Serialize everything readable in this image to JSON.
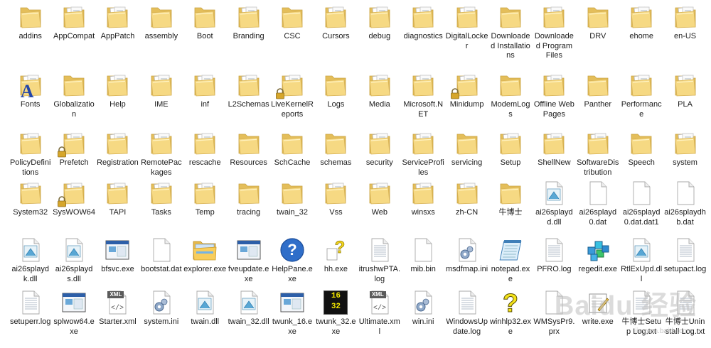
{
  "items": [
    {
      "label": "addins",
      "icon": "folder"
    },
    {
      "label": "AppCompat",
      "icon": "folder-docs"
    },
    {
      "label": "AppPatch",
      "icon": "folder-docs"
    },
    {
      "label": "assembly",
      "icon": "folder"
    },
    {
      "label": "Boot",
      "icon": "folder"
    },
    {
      "label": "Branding",
      "icon": "folder-docs"
    },
    {
      "label": "CSC",
      "icon": "folder"
    },
    {
      "label": "Cursors",
      "icon": "folder-docs"
    },
    {
      "label": "debug",
      "icon": "folder-docs"
    },
    {
      "label": "diagnostics",
      "icon": "folder-docs"
    },
    {
      "label": "DigitalLocker",
      "icon": "folder-docs"
    },
    {
      "label": "Downloaded Installations",
      "icon": "folder"
    },
    {
      "label": "Downloaded Program Files",
      "icon": "folder-docs"
    },
    {
      "label": "DRV",
      "icon": "folder"
    },
    {
      "label": "ehome",
      "icon": "folder-docs"
    },
    {
      "label": "en-US",
      "icon": "folder-docs"
    },
    {
      "label": "Fonts",
      "icon": "folder-fonts"
    },
    {
      "label": "Globalization",
      "icon": "folder"
    },
    {
      "label": "Help",
      "icon": "folder-docs"
    },
    {
      "label": "IME",
      "icon": "folder-docs"
    },
    {
      "label": "inf",
      "icon": "folder-docs"
    },
    {
      "label": "L2Schemas",
      "icon": "folder-docs"
    },
    {
      "label": "LiveKernelReports",
      "icon": "folder-locked"
    },
    {
      "label": "Logs",
      "icon": "folder"
    },
    {
      "label": "Media",
      "icon": "folder-docs"
    },
    {
      "label": "Microsoft.NET",
      "icon": "folder-docs"
    },
    {
      "label": "Minidump",
      "icon": "folder-locked"
    },
    {
      "label": "ModemLogs",
      "icon": "folder"
    },
    {
      "label": "Offline Web Pages",
      "icon": "folder-docs"
    },
    {
      "label": "Panther",
      "icon": "folder"
    },
    {
      "label": "Performance",
      "icon": "folder-docs"
    },
    {
      "label": "PLA",
      "icon": "folder-docs"
    },
    {
      "label": "PolicyDefinitions",
      "icon": "folder-docs"
    },
    {
      "label": "Prefetch",
      "icon": "folder-locked"
    },
    {
      "label": "Registration",
      "icon": "folder-docs"
    },
    {
      "label": "RemotePackages",
      "icon": "folder-docs"
    },
    {
      "label": "rescache",
      "icon": "folder-docs"
    },
    {
      "label": "Resources",
      "icon": "folder"
    },
    {
      "label": "SchCache",
      "icon": "folder"
    },
    {
      "label": "schemas",
      "icon": "folder"
    },
    {
      "label": "security",
      "icon": "folder-docs"
    },
    {
      "label": "ServiceProfiles",
      "icon": "folder-docs"
    },
    {
      "label": "servicing",
      "icon": "folder"
    },
    {
      "label": "Setup",
      "icon": "folder-docs"
    },
    {
      "label": "ShellNew",
      "icon": "folder-docs"
    },
    {
      "label": "SoftwareDistribution",
      "icon": "folder-docs"
    },
    {
      "label": "Speech",
      "icon": "folder"
    },
    {
      "label": "system",
      "icon": "folder-docs"
    },
    {
      "label": "System32",
      "icon": "folder-docs"
    },
    {
      "label": "SysWOW64",
      "icon": "folder-locked"
    },
    {
      "label": "TAPI",
      "icon": "folder-docs"
    },
    {
      "label": "Tasks",
      "icon": "folder-docs"
    },
    {
      "label": "Temp",
      "icon": "folder-docs"
    },
    {
      "label": "tracing",
      "icon": "folder"
    },
    {
      "label": "twain_32",
      "icon": "folder"
    },
    {
      "label": "Vss",
      "icon": "folder-docs"
    },
    {
      "label": "Web",
      "icon": "folder-docs"
    },
    {
      "label": "winsxs",
      "icon": "folder-docs"
    },
    {
      "label": "zh-CN",
      "icon": "folder-docs"
    },
    {
      "label": "牛博士",
      "icon": "folder"
    },
    {
      "label": "ai26splaydd.dll",
      "icon": "dll-file"
    },
    {
      "label": "ai26splayd0.dat",
      "icon": "blank-file"
    },
    {
      "label": "ai26splayd0.dat.dat1",
      "icon": "blank-file"
    },
    {
      "label": "ai26splaydhb.dat",
      "icon": "blank-file"
    },
    {
      "label": "ai26splaydk.dll",
      "icon": "dll-file"
    },
    {
      "label": "ai26splayds.dll",
      "icon": "dll-file"
    },
    {
      "label": "bfsvc.exe",
      "icon": "exe-window"
    },
    {
      "label": "bootstat.dat",
      "icon": "blank-file"
    },
    {
      "label": "explorer.exe",
      "icon": "explorer-folder"
    },
    {
      "label": "fveupdate.exe",
      "icon": "exe-window"
    },
    {
      "label": "HelpPane.exe",
      "icon": "help-circle"
    },
    {
      "label": "hh.exe",
      "icon": "hh-help"
    },
    {
      "label": "itrushwPTA.log",
      "icon": "text-file"
    },
    {
      "label": "mib.bin",
      "icon": "blank-file"
    },
    {
      "label": "msdfmap.ini",
      "icon": "settings-file"
    },
    {
      "label": "notepad.exe",
      "icon": "notepad"
    },
    {
      "label": "PFRO.log",
      "icon": "text-file"
    },
    {
      "label": "regedit.exe",
      "icon": "regedit-cubes"
    },
    {
      "label": "RtlExUpd.dll",
      "icon": "dll-file"
    },
    {
      "label": "setupact.log",
      "icon": "text-file"
    },
    {
      "label": "setuperr.log",
      "icon": "text-file"
    },
    {
      "label": "splwow64.exe",
      "icon": "exe-window"
    },
    {
      "label": "Starter.xml",
      "icon": "xml-file"
    },
    {
      "label": "system.ini",
      "icon": "settings-file"
    },
    {
      "label": "twain.dll",
      "icon": "dll-file"
    },
    {
      "label": "twain_32.dll",
      "icon": "dll-file"
    },
    {
      "label": "twunk_16.exe",
      "icon": "exe-window"
    },
    {
      "label": "twunk_32.exe",
      "icon": "twain-32-exe"
    },
    {
      "label": "Ultimate.xml",
      "icon": "xml-file"
    },
    {
      "label": "win.ini",
      "icon": "settings-file"
    },
    {
      "label": "WindowsUpdate.log",
      "icon": "text-file"
    },
    {
      "label": "winhlp32.exe",
      "icon": "winhelp-question"
    },
    {
      "label": "WMSysPr9.prx",
      "icon": "blank-file"
    },
    {
      "label": "write.exe",
      "icon": "write-pad"
    },
    {
      "label": "牛博士Setup Log.txt",
      "icon": "text-file"
    },
    {
      "label": "牛博士Uninstall Log.txt",
      "icon": "text-file"
    }
  ],
  "badges": {
    "xml": "XML",
    "twain32_top": "16",
    "twain32_bottom": "32",
    "font_letter": "A"
  },
  "watermark": {
    "text": "Baidu 经验",
    "sub": "jingyan.baidu.com"
  },
  "colors": {
    "folder_back": "#e8c564",
    "folder_front": "#f8dd87",
    "folder_edge": "#c9a343",
    "paper": "#ffffff",
    "accent_blue": "#2f6ec9"
  }
}
